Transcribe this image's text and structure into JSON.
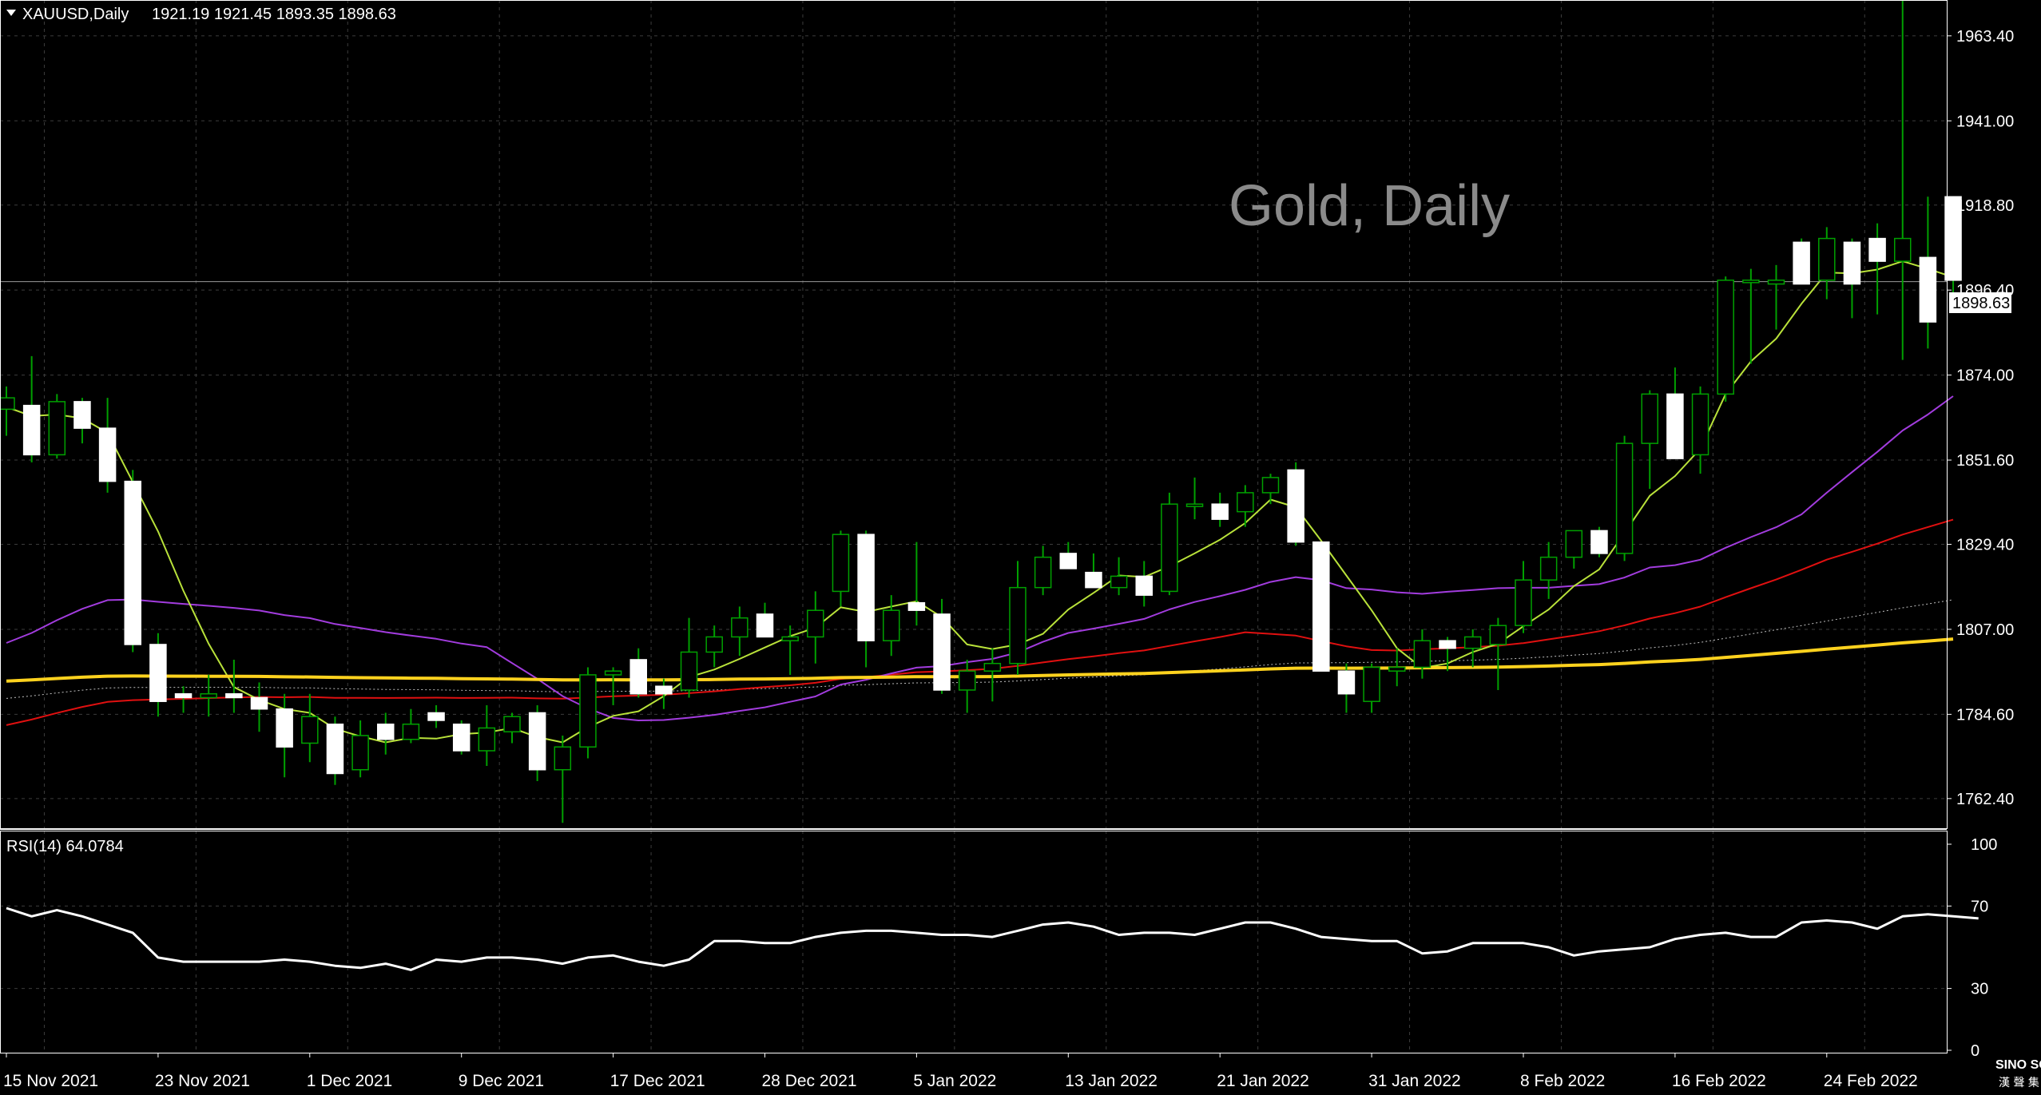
{
  "header": {
    "symbol": "XAUUSD,Daily",
    "ohlc": "1921.19 1921.45 1893.35 1898.63"
  },
  "watermark": "Gold, Daily",
  "current_price_label": "1898.63",
  "rsi_header": "RSI(14) 64.0784",
  "logo": {
    "line1": "SINO SOUND",
    "line2": "漢 聲 集 團"
  },
  "colors": {
    "background": "#000000",
    "grid": "#3c3c3c",
    "bull_outline": "#00a000",
    "bull_fill": "#000000",
    "bear_fill": "#ffffff",
    "text": "#ffffff",
    "ma_fast": "#b9e23a",
    "ma_mid": "#a23cde",
    "ma_red": "#e01010",
    "ma_yellow": "#ffd21e",
    "ma_dotted": "#c0c0c0",
    "rsi_line": "#ffffff"
  },
  "chart_data": [
    {
      "type": "candlestick",
      "title": "XAUUSD,Daily",
      "watermark": "Gold, Daily",
      "y_ticks": [
        1963.4,
        1941.0,
        1918.8,
        1896.4,
        1874.0,
        1851.6,
        1829.4,
        1807.0,
        1784.6,
        1762.4
      ],
      "y_tick_labels": [
        "1963.40",
        "1941.00",
        "1918.80",
        "1896.40",
        "1874.00",
        "1851.60",
        "1829.40",
        "1807.00",
        "1784.60",
        "1762.40"
      ],
      "ylim": [
        1755.0,
        1972.0
      ],
      "x_labels": [
        "15 Nov 2021",
        "23 Nov 2021",
        "1 Dec 2021",
        "9 Dec 2021",
        "17 Dec 2021",
        "28 Dec 2021",
        "5 Jan 2022",
        "13 Jan 2022",
        "21 Jan 2022",
        "31 Jan 2022",
        "8 Feb 2022",
        "16 Feb 2022",
        "24 Feb 2022"
      ],
      "x_label_index": [
        0,
        6,
        12,
        18,
        24,
        30,
        36,
        42,
        48,
        54,
        60,
        66,
        72
      ],
      "last_price": 1898.63,
      "candles": [
        [
          1865,
          1871,
          1858,
          1868
        ],
        [
          1866,
          1879,
          1851,
          1853
        ],
        [
          1853,
          1869,
          1852,
          1867
        ],
        [
          1867,
          1868,
          1856,
          1860
        ],
        [
          1860,
          1868,
          1843,
          1846
        ],
        [
          1846,
          1849,
          1801,
          1803
        ],
        [
          1803,
          1806,
          1784,
          1788
        ],
        [
          1790,
          1792,
          1785,
          1789
        ],
        [
          1789,
          1795,
          1784,
          1790
        ],
        [
          1790,
          1799,
          1785,
          1789
        ],
        [
          1789,
          1793,
          1780,
          1786
        ],
        [
          1786,
          1790,
          1768,
          1776
        ],
        [
          1777,
          1790,
          1772,
          1784
        ],
        [
          1782,
          1784,
          1766,
          1769
        ],
        [
          1770,
          1783,
          1768,
          1779
        ],
        [
          1782,
          1785,
          1774,
          1778
        ],
        [
          1778,
          1786,
          1777,
          1782
        ],
        [
          1785,
          1787,
          1781,
          1783
        ],
        [
          1782,
          1783,
          1774,
          1775
        ],
        [
          1775,
          1787,
          1771,
          1781
        ],
        [
          1780,
          1785,
          1777,
          1784
        ],
        [
          1785,
          1787,
          1767,
          1770
        ],
        [
          1770,
          1779,
          1756,
          1776
        ],
        [
          1776,
          1797,
          1773,
          1795
        ],
        [
          1795,
          1797,
          1787,
          1796
        ],
        [
          1799,
          1802,
          1789,
          1790
        ],
        [
          1792,
          1794,
          1786,
          1790
        ],
        [
          1791,
          1810,
          1789,
          1801
        ],
        [
          1801,
          1808,
          1797,
          1805
        ],
        [
          1805,
          1813,
          1800,
          1810
        ],
        [
          1811,
          1814,
          1805,
          1805
        ],
        [
          1804,
          1808,
          1795,
          1805
        ],
        [
          1805,
          1817,
          1798,
          1812
        ],
        [
          1817,
          1833,
          1813,
          1832
        ],
        [
          1832,
          1833,
          1797,
          1804
        ],
        [
          1804,
          1816,
          1800,
          1812
        ],
        [
          1814,
          1830,
          1808,
          1812
        ],
        [
          1811,
          1815,
          1790,
          1791
        ],
        [
          1791,
          1799,
          1785,
          1796
        ],
        [
          1796,
          1802,
          1788,
          1798
        ],
        [
          1798,
          1825,
          1795,
          1818
        ],
        [
          1818,
          1829,
          1816,
          1826
        ],
        [
          1827,
          1830,
          1823,
          1823
        ],
        [
          1822,
          1827,
          1818,
          1818
        ],
        [
          1818,
          1826,
          1816,
          1821
        ],
        [
          1821,
          1825,
          1813,
          1816
        ],
        [
          1817,
          1843,
          1816,
          1840
        ],
        [
          1840,
          1847,
          1836,
          1840
        ],
        [
          1840,
          1843,
          1834,
          1836
        ],
        [
          1838,
          1845,
          1834,
          1843
        ],
        [
          1843,
          1848,
          1840,
          1847
        ],
        [
          1849,
          1851,
          1829,
          1830
        ],
        [
          1830,
          1830,
          1796,
          1796
        ],
        [
          1796,
          1798,
          1785,
          1790
        ],
        [
          1788,
          1798,
          1785,
          1797
        ],
        [
          1796,
          1802,
          1792,
          1797
        ],
        [
          1797,
          1807,
          1794,
          1804
        ],
        [
          1804,
          1805,
          1796,
          1802
        ],
        [
          1802,
          1807,
          1797,
          1805
        ],
        [
          1803,
          1810,
          1791,
          1808
        ],
        [
          1808,
          1825,
          1806,
          1820
        ],
        [
          1820,
          1830,
          1815,
          1826
        ],
        [
          1826,
          1833,
          1823,
          1833
        ],
        [
          1833,
          1834,
          1826,
          1827
        ],
        [
          1827,
          1858,
          1825,
          1856
        ],
        [
          1856,
          1870,
          1844,
          1869
        ],
        [
          1869,
          1876,
          1852,
          1852
        ],
        [
          1853,
          1871,
          1848,
          1869
        ],
        [
          1869,
          1900,
          1867,
          1899
        ],
        [
          1899,
          1902,
          1877,
          1899
        ],
        [
          1898,
          1903,
          1886,
          1899
        ],
        [
          1909,
          1910,
          1898,
          1898
        ],
        [
          1899,
          1913,
          1894,
          1910
        ],
        [
          1909,
          1910,
          1889,
          1898
        ],
        [
          1910,
          1914,
          1890,
          1904
        ],
        [
          1904,
          1974,
          1878,
          1910
        ],
        [
          1905,
          1921,
          1881,
          1888
        ],
        [
          1921,
          1921,
          1893,
          1899
        ]
      ]
    },
    {
      "type": "line",
      "title": "RSI(14) 64.0784",
      "y_ticks": [
        100,
        70,
        30,
        0
      ],
      "y_tick_labels": [
        "100",
        "70",
        "30",
        "0"
      ],
      "ylim": [
        0,
        100
      ],
      "values": [
        69,
        65,
        68,
        65,
        61,
        57,
        45,
        43,
        43,
        43,
        43,
        44,
        43,
        41,
        40,
        42,
        39,
        44,
        43,
        45,
        45,
        44,
        42,
        45,
        46,
        43,
        41,
        44,
        53,
        53,
        52,
        52,
        55,
        57,
        58,
        58,
        57,
        56,
        56,
        55,
        58,
        61,
        62,
        60,
        56,
        57,
        57,
        56,
        59,
        62,
        62,
        59,
        55,
        54,
        53,
        53,
        47,
        48,
        52,
        52,
        52,
        50,
        46,
        48,
        49,
        50,
        54,
        56,
        57,
        55,
        55,
        62,
        63,
        62,
        59,
        65,
        66,
        65,
        64
      ]
    }
  ]
}
